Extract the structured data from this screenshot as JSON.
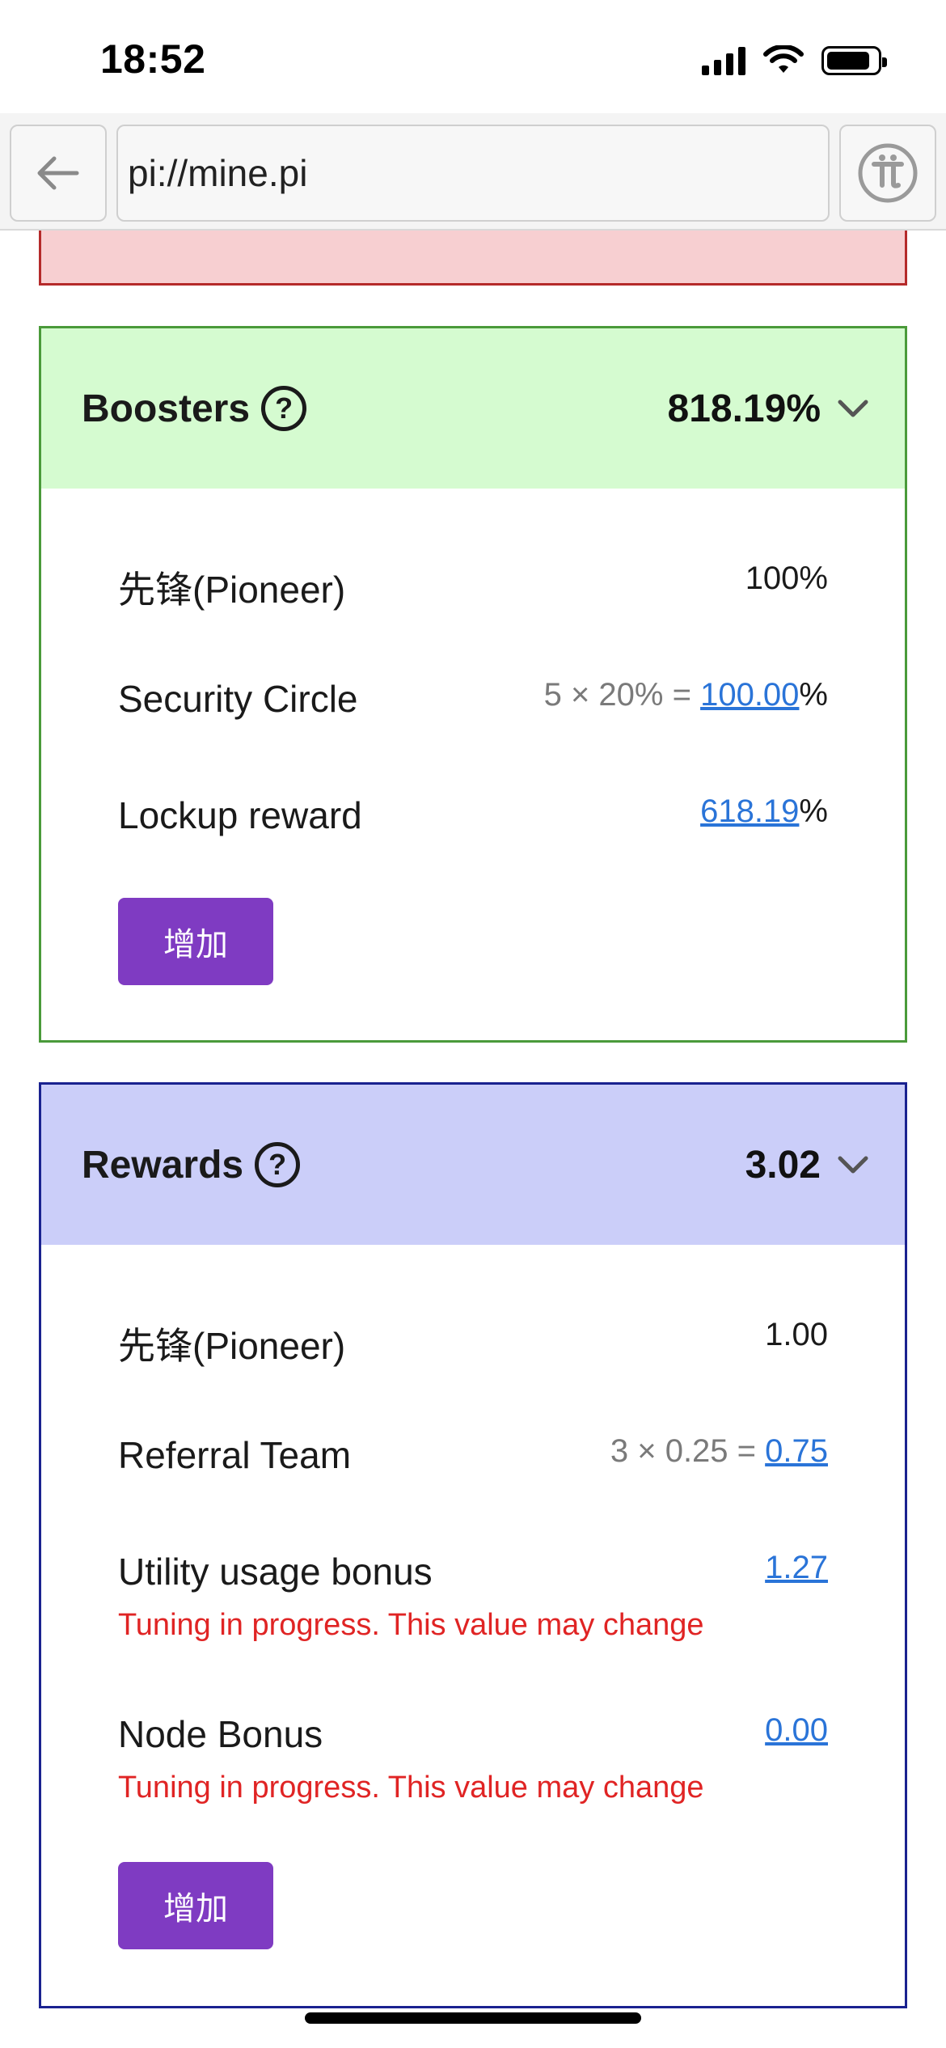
{
  "status_bar": {
    "time": "18:52"
  },
  "browser": {
    "url": "pi://mine.pi"
  },
  "boosters": {
    "title": "Boosters",
    "total": "818.19%",
    "rows": [
      {
        "label": "先锋(Pioneer)",
        "value": "100%"
      },
      {
        "label": "Security Circle",
        "formula": "5 × 20% = ",
        "link_value": "100.00",
        "suffix": "%"
      },
      {
        "label": "Lockup reward",
        "link_value": "618.19",
        "suffix": "%"
      }
    ],
    "button_label": "增加"
  },
  "rewards": {
    "title": "Rewards",
    "total": "3.02",
    "rows": [
      {
        "label": "先锋(Pioneer)",
        "value": "1.00"
      },
      {
        "label": "Referral Team",
        "formula": "3 × 0.25 = ",
        "link_value": "0.75"
      },
      {
        "label": "Utility usage bonus",
        "link_value": "1.27",
        "note": "Tuning in progress. This value may change"
      },
      {
        "label": "Node Bonus",
        "link_value": "0.00",
        "note": "Tuning in progress. This value may change"
      }
    ],
    "button_label": "增加"
  },
  "colors": {
    "boosters_header_bg": "#d5fbd0",
    "boosters_border": "#4a9a3a",
    "rewards_header_bg": "#cbcef9",
    "rewards_border": "#1a2290",
    "button_bg": "#7f3bc2",
    "link": "#2a74d8",
    "warning": "#e02424",
    "alert_bg": "#f7cfd1"
  },
  "icons": [
    "back-arrow-icon",
    "pi-logo-icon",
    "help-icon",
    "chevron-down-icon",
    "cellular-signal-icon",
    "wifi-icon",
    "battery-icon"
  ]
}
